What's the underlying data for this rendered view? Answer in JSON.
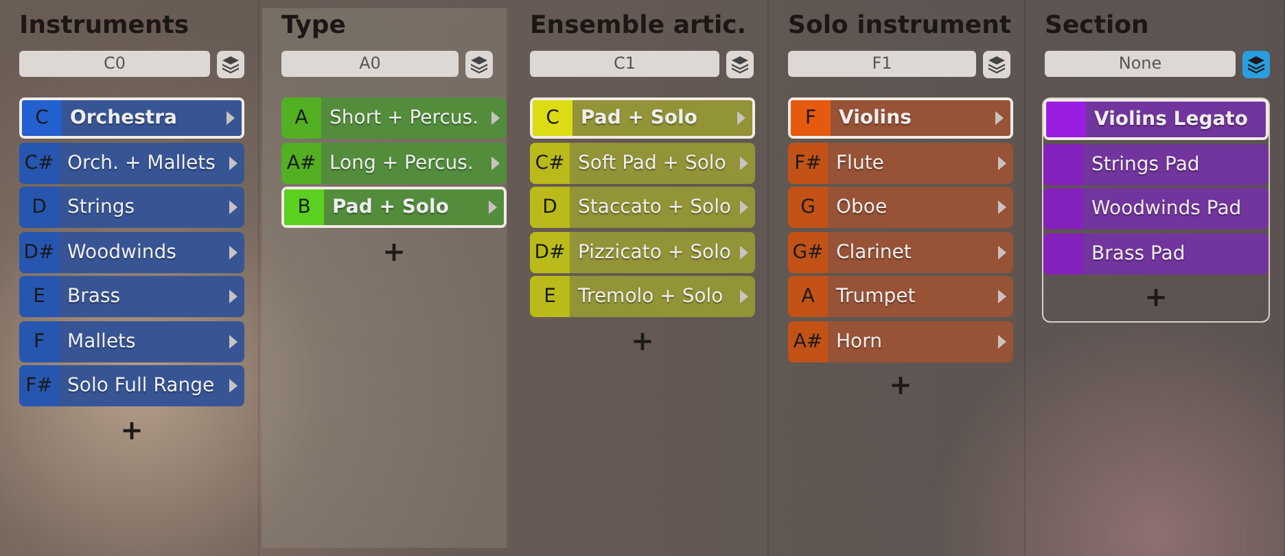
{
  "columns": [
    {
      "title": "Instruments",
      "value": "C0",
      "layers_active": false,
      "highlighted": false,
      "grouped": false,
      "has_submenu": true,
      "color": "#2360d0",
      "add": "+",
      "items": [
        {
          "key": "C",
          "label": "Orchestra",
          "selected": true
        },
        {
          "key": "C#",
          "label": "Orch. + Mallets",
          "selected": false
        },
        {
          "key": "D",
          "label": "Strings",
          "selected": false
        },
        {
          "key": "D#",
          "label": "Woodwinds",
          "selected": false
        },
        {
          "key": "E",
          "label": "Brass",
          "selected": false
        },
        {
          "key": "F",
          "label": "Mallets",
          "selected": false
        },
        {
          "key": "F#",
          "label": "Solo Full Range",
          "selected": false
        }
      ]
    },
    {
      "title": "Type",
      "value": "A0",
      "layers_active": false,
      "highlighted": true,
      "grouped": false,
      "has_submenu": true,
      "color": "#5bd01e",
      "add": "+",
      "items": [
        {
          "key": "A",
          "label": "Short + Percus.",
          "selected": false
        },
        {
          "key": "A#",
          "label": "Long + Percus.",
          "selected": false
        },
        {
          "key": "B",
          "label": "Pad + Solo",
          "selected": true
        }
      ]
    },
    {
      "title": "Ensemble artic.",
      "value": "C1",
      "layers_active": false,
      "highlighted": false,
      "grouped": false,
      "has_submenu": true,
      "color": "#dcdc14",
      "add": "+",
      "items": [
        {
          "key": "C",
          "label": "Pad + Solo",
          "selected": true
        },
        {
          "key": "C#",
          "label": "Soft Pad + Solo",
          "selected": false
        },
        {
          "key": "D",
          "label": "Staccato + Solo",
          "selected": false
        },
        {
          "key": "D#",
          "label": "Pizzicato + Solo",
          "selected": false
        },
        {
          "key": "E",
          "label": "Tremolo + Solo",
          "selected": false
        }
      ]
    },
    {
      "title": "Solo instrument",
      "value": "F1",
      "layers_active": false,
      "highlighted": false,
      "grouped": false,
      "has_submenu": true,
      "color": "#e65a10",
      "add": "+",
      "items": [
        {
          "key": "F",
          "label": "Violins",
          "selected": true
        },
        {
          "key": "F#",
          "label": "Flute",
          "selected": false
        },
        {
          "key": "G",
          "label": "Oboe",
          "selected": false
        },
        {
          "key": "G#",
          "label": "Clarinet",
          "selected": false
        },
        {
          "key": "A",
          "label": "Trumpet",
          "selected": false
        },
        {
          "key": "A#",
          "label": "Horn",
          "selected": false
        }
      ]
    },
    {
      "title": "Section",
      "value": "None",
      "layers_active": true,
      "highlighted": false,
      "grouped": true,
      "has_submenu": false,
      "color": "#9a1ee0",
      "add": "+",
      "items": [
        {
          "label": "Violins Legato",
          "selected": true
        },
        {
          "label": "Strings Pad",
          "selected": false
        },
        {
          "label": "Woodwinds Pad",
          "selected": false
        },
        {
          "label": "Brass Pad",
          "selected": false
        }
      ]
    }
  ]
}
